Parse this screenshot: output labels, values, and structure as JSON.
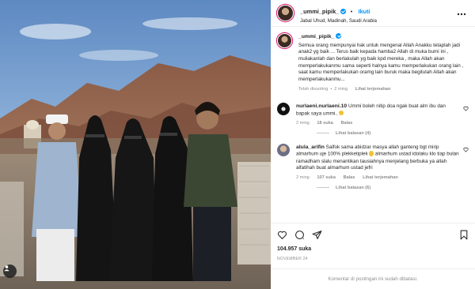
{
  "post": {
    "username": "_ummi_pipik_",
    "follow_label": "Ikuti",
    "separator": "•",
    "location": "Jabal Uhud, Madinah, Saudi Arabia",
    "more_icon": "more-horizontal-icon"
  },
  "caption": {
    "username": "_ummi_pipik_",
    "text": "Semua orang mempunyai hak untuk mengenal Allah Anakku tetaplah jadi anak2 yg baik ... Terus baik kepada hamba2 Allah di muka bumi ini , muliakanlah dan berlakulah yg baik kpd mereka , maka Allah akan memperlakukanmu sama seperti halnya kamu memperlakukan orang lain , saat kamu memperlakukan oramg lain buruk maka begitulah Allah akan memperlakukanmu...",
    "edited": "Telah disunting",
    "time": "2 ming",
    "see_translation": "Lihat terjemahan"
  },
  "comments": [
    {
      "username": "nurlaeni.nurlaeni.10",
      "text": "Ummi boleh nitip doa ngak buat alm ibu dan bapak saya ummi..",
      "emoji": "pray-emoji",
      "time": "2 ming",
      "likes": "18 suka",
      "reply_label": "Balas",
      "replies": "Lihat balasan (4)"
    },
    {
      "username": "alula_arifin",
      "text": "Salfok sama abidzar masya allah ganteng bgt mirip almarhum uje 100% plekketiplek",
      "text_end": "almarhum ustad idolaku klo tiap bulan ramadham slalu menantikan tausiahnya menjelang berbuka ya allah alfatihah buat almarhum ustad jefri",
      "emoji": "smile-emoji",
      "time": "2 ming",
      "likes": "107 suka",
      "reply_label": "Balas",
      "translate_label": "Lihat terjemahan",
      "replies": "Lihat balasan (6)"
    }
  ],
  "actions": {
    "likes": "104.957 suka",
    "date": "NOVEMBER 24"
  },
  "footer": {
    "text": "Komentar di postingan ini sudah dibatasi."
  },
  "colors": {
    "accent": "#0095f6",
    "muted": "#8e8e8e",
    "border": "#efefef"
  }
}
